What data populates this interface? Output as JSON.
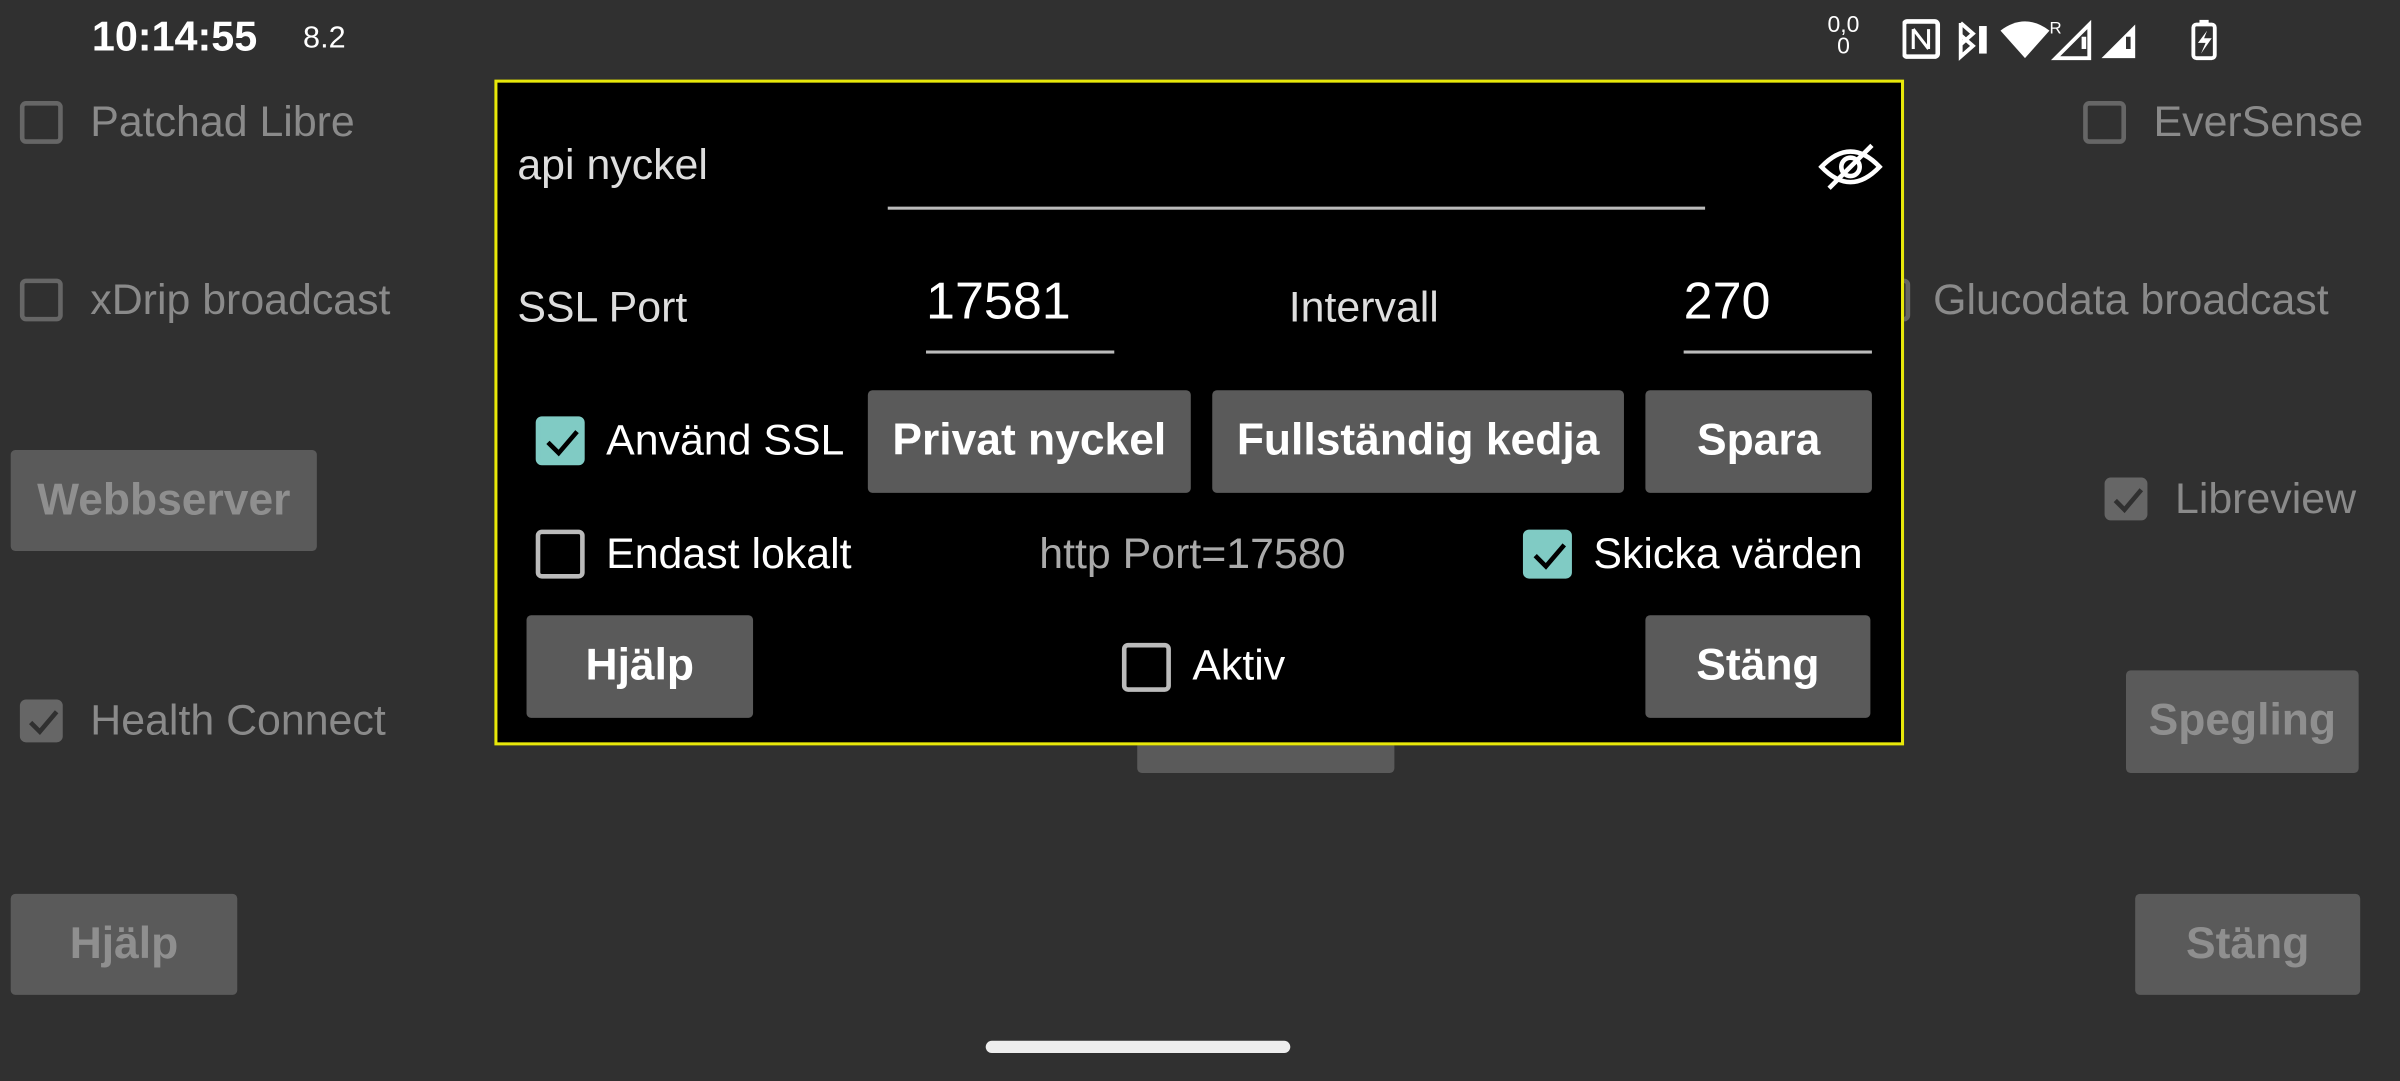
{
  "status_bar": {
    "time": "10:14:55",
    "extra": "8.2",
    "network_speed": "0,0\n0",
    "icons": [
      "nfc-icon",
      "bluetooth-icon",
      "wifi-icon",
      "signal-roaming-icon",
      "signal-icon",
      "battery-charging-icon"
    ]
  },
  "background": {
    "checkboxes_left": [
      {
        "label": "Patchad Libre",
        "checked": false
      },
      {
        "label": "xDrip broadcast",
        "checked": false
      },
      {
        "label": "Health Connect",
        "checked": true
      }
    ],
    "checkboxes_right": [
      {
        "label": "EverSense",
        "checked": false
      },
      {
        "label": "Glucodata broadcast",
        "checked": false
      },
      {
        "label": "Libreview",
        "checked": true
      }
    ],
    "webserver_button": "Webbserver",
    "mirror_button": "Spegling",
    "help_button": "Hjälp",
    "close_button": "Stäng"
  },
  "dialog": {
    "api_key_label": "api nyckel",
    "api_key_value": "",
    "ssl_port_label": "SSL Port",
    "ssl_port_value": "17581",
    "interval_label": "Intervall",
    "interval_value": "270",
    "use_ssl": {
      "label": "Använd SSL",
      "checked": true
    },
    "private_key_button": "Privat nyckel",
    "full_chain_button": "Fullständig kedja",
    "save_button": "Spara",
    "local_only": {
      "label": "Endast lokalt",
      "checked": false
    },
    "http_port_text": "http Port=17580",
    "send_values": {
      "label": "Skicka värden",
      "checked": true
    },
    "help_button": "Hjälp",
    "active": {
      "label": "Aktiv",
      "checked": false
    },
    "close_button": "Stäng",
    "accent_color": "#80cbc4",
    "border_color": "#e8e80a"
  }
}
